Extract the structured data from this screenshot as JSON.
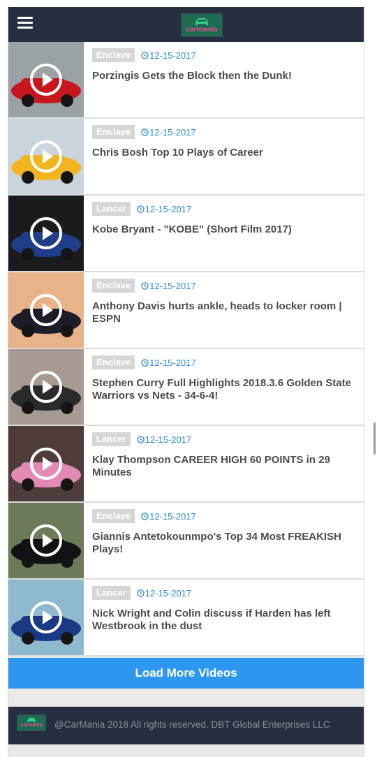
{
  "header": {
    "menu_icon": "hamburger-menu-icon",
    "logo_text": "carmania"
  },
  "videos": [
    {
      "category": "Enclave",
      "date": "12-15-2017",
      "title": "Porzingis Gets the Block then the Dunk!",
      "thumb_colors": [
        "#9aa2a6",
        "#c8171c"
      ]
    },
    {
      "category": "Enclave",
      "date": "12-15-2017",
      "title": "Chris Bosh Top 10 Plays of Career",
      "thumb_colors": [
        "#c9d4dc",
        "#f2b51f"
      ]
    },
    {
      "category": "Lancer",
      "date": "12-15-2017",
      "title": "Kobe Bryant - \"KOBE\" (Short Film 2017)",
      "thumb_colors": [
        "#1a1a1f",
        "#1f3d88"
      ]
    },
    {
      "category": "Enclave",
      "date": "12-15-2017",
      "title": "Anthony Davis hurts ankle, heads to locker room | ESPN",
      "thumb_colors": [
        "#e8b389",
        "#1c1d28"
      ]
    },
    {
      "category": "Enclave",
      "date": "12-15-2017",
      "title": "Stephen Curry Full Highlights 2018.3.6 Golden State Warriors vs Nets - 34-6-4!",
      "thumb_colors": [
        "#a79a92",
        "#2a2a2e"
      ]
    },
    {
      "category": "Lancer",
      "date": "12-15-2017",
      "title": "Klay Thompson CAREER HIGH 60 POINTS in 29 Minutes",
      "thumb_colors": [
        "#4e3c3b",
        "#e38ab4"
      ]
    },
    {
      "category": "Enclave",
      "date": "12-15-2017",
      "title": "Giannis Antetokounmpo's Top 34 Most FREAKISH Plays!",
      "thumb_colors": [
        "#6d7a5a",
        "#111216"
      ]
    },
    {
      "category": "Lancer",
      "date": "12-15-2017",
      "title": "Nick Wright and Colin discuss if Harden has left Westbrook in the dust",
      "thumb_colors": [
        "#8fb9cf",
        "#1a3a86"
      ]
    }
  ],
  "load_more_label": "Load More Videos",
  "footer": {
    "logo_text": "carmania",
    "copyright": "@CarMania 2018 All rights reserved. DBT Global Enterprises LLC"
  },
  "colors": {
    "navbar": "#262f3f",
    "accent_blue": "#2d97f0",
    "date_blue": "#2a8ad9",
    "tag_gray": "#d6d6d6"
  },
  "icons": {
    "play": "play-circle-icon",
    "clock": "clock-icon"
  }
}
